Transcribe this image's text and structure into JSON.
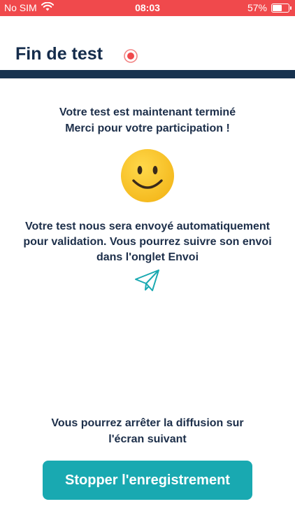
{
  "status_bar": {
    "carrier": "No SIM",
    "time": "08:03",
    "battery_percent": "57%",
    "battery_level": 0.57,
    "background_color": "#f0494c"
  },
  "header": {
    "title": "Fin de test",
    "record_icon": "record-icon",
    "bar_color": "#17324f"
  },
  "content": {
    "finished_line1": "Votre test est maintenant terminé",
    "finished_line2": "Merci pour votre participation !",
    "smiley_icon": "smiley-icon",
    "sending_info": "Votre test nous sera envoyé automatiquement pour validation. Vous pourrez suivre son envoi dans l'onglet Envoi",
    "send_icon": "paper-plane-icon",
    "stop_info_line1": "Vous pourrez arrêter la diffusion sur",
    "stop_info_line2": "l'écran suivant"
  },
  "actions": {
    "stop_button_label": "Stopper l'enregistrement",
    "button_color": "#19a9b1"
  }
}
